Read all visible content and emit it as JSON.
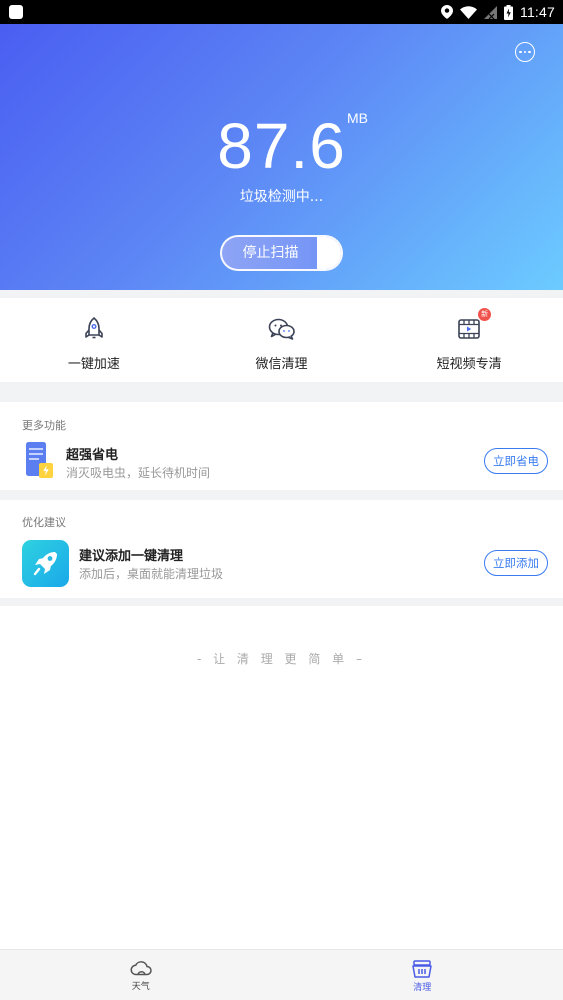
{
  "status_bar": {
    "time": "11:47",
    "icons": [
      "app-icon",
      "location-icon",
      "wifi-icon",
      "signal-icon",
      "battery-icon"
    ]
  },
  "header": {
    "more_icon": "more-horizontal-icon",
    "size_value": "87.6",
    "size_unit": "MB",
    "scan_status": "垃圾检测中...",
    "stop_button": "停止扫描"
  },
  "quick_actions": [
    {
      "label": "一键加速",
      "icon": "rocket-icon"
    },
    {
      "label": "微信清理",
      "icon": "wechat-icon"
    },
    {
      "label": "短视频专清",
      "icon": "video-icon",
      "badge": "新"
    }
  ],
  "more_features": {
    "title": "更多功能",
    "item": {
      "name": "超强省电",
      "desc": "消灭吸电虫，延长待机时间",
      "button": "立即省电",
      "icon": "battery-saver-icon"
    }
  },
  "suggestions": {
    "title": "优化建议",
    "item": {
      "name": "建议添加一键清理",
      "desc": "添加后，桌面就能清理垃圾",
      "button": "立即添加",
      "icon": "rocket-app-icon"
    }
  },
  "slogan": "- 让 清 理 更 简 单 –",
  "tabs": [
    {
      "label": "天气",
      "icon": "cloud-icon",
      "active": false
    },
    {
      "label": "清理",
      "icon": "basket-icon",
      "active": true
    }
  ],
  "colors": {
    "accent": "#3a7cf0",
    "gradient_start": "#4a5ef2",
    "gradient_end": "#6ccbff",
    "badge": "#f0534b",
    "tab_active": "#4a5be6"
  }
}
